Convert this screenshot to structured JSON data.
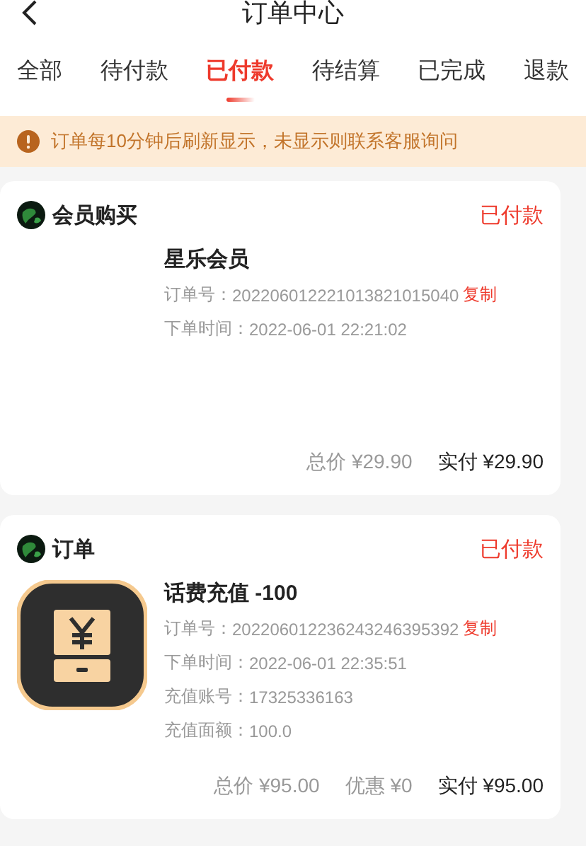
{
  "header": {
    "title": "订单中心"
  },
  "tabs": [
    {
      "label": "全部",
      "selected": false
    },
    {
      "label": "待付款",
      "selected": false
    },
    {
      "label": "已付款",
      "selected": true
    },
    {
      "label": "待结算",
      "selected": false
    },
    {
      "label": "已完成",
      "selected": false
    },
    {
      "label": "退款",
      "selected": false
    }
  ],
  "notice": {
    "text": "订单每10分钟后刷新显示，未显示则联系客服询问"
  },
  "orders": [
    {
      "shop": "会员购买",
      "status": "已付款",
      "has_thumbnail": false,
      "title": "星乐会员",
      "details": [
        {
          "label": "订单号：",
          "value": "202206012221013821015040",
          "copy": "复制"
        },
        {
          "label": "下单时间：",
          "value": "2022-06-01 22:21:02"
        }
      ],
      "totals": [
        {
          "label": "总价",
          "value": "¥29.90",
          "kind": "muted"
        },
        {
          "label": "实付",
          "value": "¥29.90",
          "kind": "strong"
        }
      ]
    },
    {
      "shop": "订单",
      "status": "已付款",
      "has_thumbnail": true,
      "title": "话费充值 -100",
      "details": [
        {
          "label": "订单号：",
          "value": "202206012236243246395392",
          "copy": "复制"
        },
        {
          "label": "下单时间：",
          "value": "2022-06-01 22:35:51"
        },
        {
          "label": "充值账号：",
          "value": "17325336163"
        },
        {
          "label": "充值面额：",
          "value": "100.0"
        }
      ],
      "totals": [
        {
          "label": "总价",
          "value": "¥95.00",
          "kind": "muted"
        },
        {
          "label": "优惠",
          "value": "¥0",
          "kind": "muted"
        },
        {
          "label": "实付",
          "value": "¥95.00",
          "kind": "strong"
        }
      ]
    }
  ]
}
